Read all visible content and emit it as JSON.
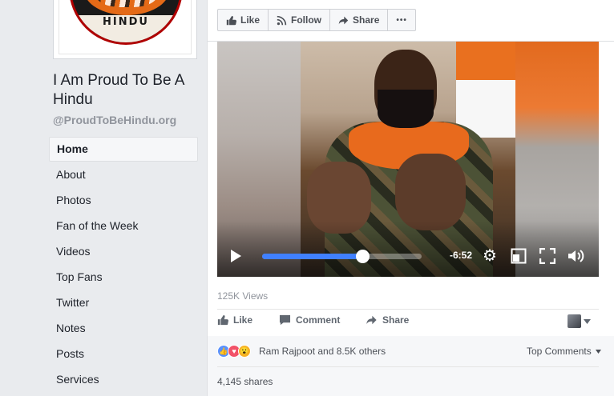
{
  "page": {
    "logo_text": "HINDU",
    "name": "I Am Proud To Be A Hindu",
    "handle": "@ProudToBeHindu.org"
  },
  "nav": {
    "items": [
      {
        "label": "Home"
      },
      {
        "label": "About"
      },
      {
        "label": "Photos"
      },
      {
        "label": "Fan of the Week"
      },
      {
        "label": "Videos"
      },
      {
        "label": "Top Fans"
      },
      {
        "label": "Twitter"
      },
      {
        "label": "Notes"
      },
      {
        "label": "Posts"
      },
      {
        "label": "Services"
      }
    ],
    "active": "Home"
  },
  "toolbar": {
    "like_label": "Like",
    "follow_label": "Follow",
    "share_label": "Share",
    "more_label": "•••"
  },
  "video": {
    "remaining_time": "-6:52",
    "progress_fraction": 0.63
  },
  "post": {
    "views": "125K Views",
    "like_label": "Like",
    "comment_label": "Comment",
    "share_label": "Share",
    "reactions_text": "Ram Rajpoot and 8.5K others",
    "top_comments_label": "Top Comments",
    "shares_text": "4,145 shares"
  },
  "colors": {
    "accent": "#4080ff",
    "like_blue": "#5890ff",
    "love_red": "#f25268",
    "wow_yellow": "#f7b125"
  }
}
